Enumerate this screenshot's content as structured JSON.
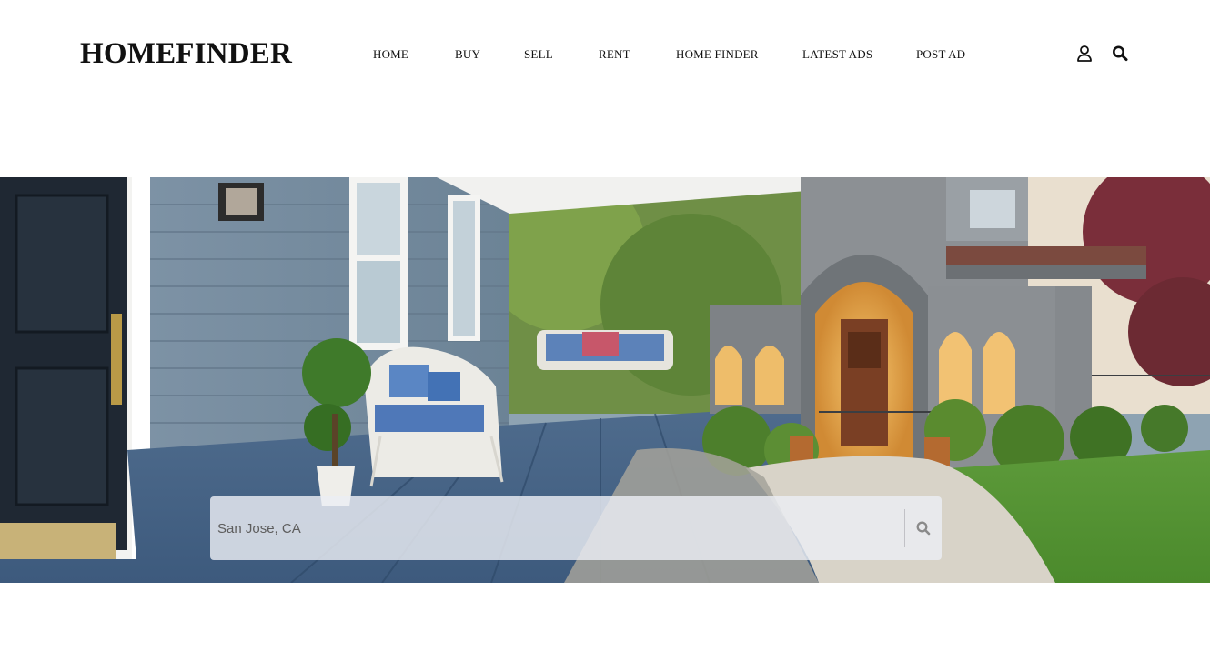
{
  "brand": {
    "logo_text": "HOMEFINDER"
  },
  "nav": {
    "items": [
      {
        "label": "HOME"
      },
      {
        "label": "BUY"
      },
      {
        "label": "SELL"
      },
      {
        "label": "RENT"
      },
      {
        "label": "HOME FINDER"
      },
      {
        "label": "LATEST ADS"
      },
      {
        "label": "POST AD"
      }
    ]
  },
  "header_icons": {
    "account": "user-icon",
    "search": "search-icon"
  },
  "hero": {
    "image": "porch-and-house-photo",
    "search": {
      "placeholder": "San Jose, CA",
      "value": "",
      "button_icon": "search-icon"
    }
  },
  "colors": {
    "text": "#111111",
    "search_icon": "#8a8a8a"
  }
}
